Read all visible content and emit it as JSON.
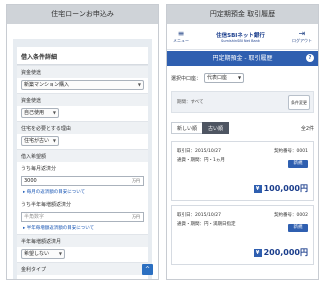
{
  "loan_panel": {
    "header": "住宅ローンお申込み",
    "section_title": "借入条件詳細",
    "fields": [
      {
        "label": "資金使途",
        "type": "select",
        "value": "新築マンション購入"
      },
      {
        "label": "資金使途",
        "type": "select",
        "value": "自己使用"
      },
      {
        "label": "住宅を必要とする理由",
        "type": "select",
        "value": "住宅が古い"
      }
    ],
    "amount_section": "借入希望額",
    "principal_label": "うち毎月返済分",
    "principal_value": "3000",
    "principal_unit": "万円",
    "link1": "毎月の返済額の目安について",
    "bonus_label": "うち半年毎増額返済分",
    "bonus_placeholder": "半角数字",
    "bonus_unit": "万円",
    "link2": "半年毎増額返済額の目安について",
    "bonus_months_label": "半年毎増額返済月",
    "bonus_months_value": "希望しない",
    "rate_type_label": "金利タイプ",
    "scroll_up": "^"
  },
  "history_panel": {
    "header": "円定期預金 取引履歴",
    "menu_label": "メニュー",
    "menu_icon": "hamburger-icon",
    "bank_name": "住信SBIネット銀行",
    "bank_sub": "SumishinSBI Net Bank",
    "logout_label": "ログアウト",
    "logout_icon": "logout-icon",
    "title": "円定期預金 - 取引履歴",
    "help": "?",
    "account_label": "選択中口座：",
    "account_value": "代表口座",
    "period_label": "期間：すべて",
    "change_button": "条件変更",
    "sort_tabs": [
      "新しい順",
      "古い順"
    ],
    "active_sort": 1,
    "count": "全2件",
    "records": [
      {
        "contract_date": "取引日：2015/10/27",
        "contract_no": "契約番号：0001",
        "detail": "通貨・期間：円・1ヵ月",
        "badge": "新規",
        "amount": "100,000円"
      },
      {
        "contract_date": "取引日：2015/10/27",
        "contract_no": "契約番号：0002",
        "detail": "通貨・期間：円・満期日指定",
        "badge": "新規",
        "amount": "200,000円"
      }
    ],
    "accent": "#2f5fb0"
  }
}
